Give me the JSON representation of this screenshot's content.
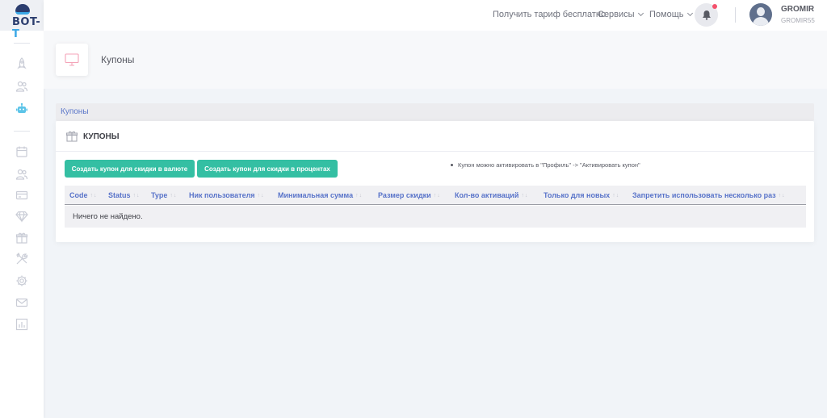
{
  "brand": {
    "logo_text_main": "BOT-",
    "logo_text_accent": "T"
  },
  "header": {
    "nav": {
      "free_plan": "Получить тариф бесплатно",
      "services": "Сервисы",
      "help": "Помощь"
    },
    "user": {
      "name": "GROMIR",
      "login": "GROMIR55"
    },
    "notification_badge_color": "#f4516c"
  },
  "subheader": {
    "title": "Купоны",
    "icon": "monitor-icon"
  },
  "breadcrumb": {
    "label": "Купоны"
  },
  "portlet": {
    "title": "КУПОНЫ",
    "buttons": {
      "create_currency": "Создать купон для скидки в валюте",
      "create_percent": "Создать купон для скидки в процентах"
    },
    "hint": "Купон можно активировать в \"Профиль\" -> \"Активировать купон\""
  },
  "table": {
    "columns": [
      "Code",
      "Status",
      "Type",
      "Ник пользователя",
      "Минимальная сумма",
      "Размер скидки",
      "Кол-во активаций",
      "Только для новых",
      "Запретить использовать несколько раз"
    ],
    "sort_glyph": "↑↓",
    "empty_message": "Ничего не найдено."
  },
  "sidebar": {
    "icons": [
      "rocket-icon",
      "users-icon",
      "robot-icon",
      "calendar-icon",
      "user-group-icon",
      "credit-card-icon",
      "diamond-icon",
      "gift-icon",
      "tools-icon",
      "settings-icon",
      "mail-icon",
      "chart-icon"
    ],
    "active_icon": "robot-icon"
  },
  "colors": {
    "accent_green": "#34bfa3",
    "link_blue": "#5873c9",
    "active_sidebar": "#5cc4e8"
  }
}
